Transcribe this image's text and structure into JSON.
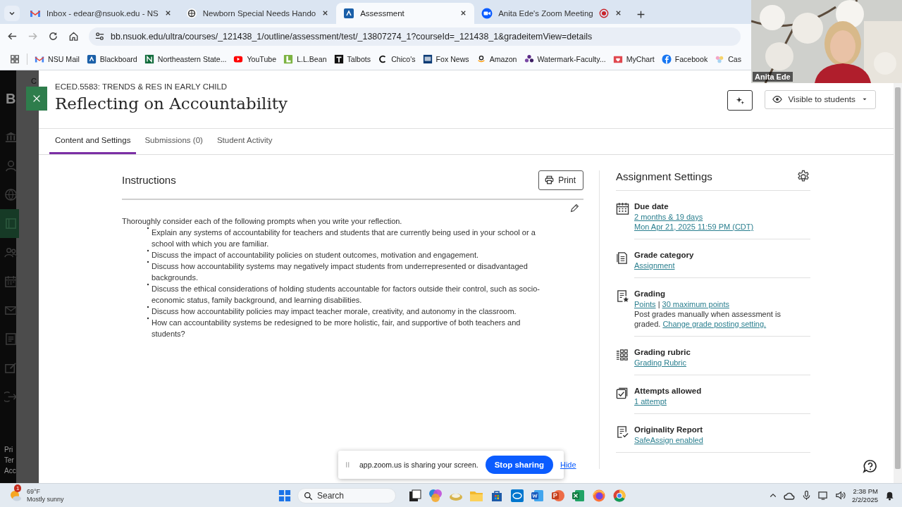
{
  "browser": {
    "tabs": [
      {
        "title": "Inbox - edear@nsuok.edu - NS",
        "selected": false,
        "recording": false
      },
      {
        "title": "Newborn Special Needs Hando",
        "selected": false,
        "recording": false
      },
      {
        "title": "Assessment",
        "selected": true,
        "recording": false
      },
      {
        "title": "Anita Ede's Zoom Meeting",
        "selected": false,
        "recording": true
      }
    ],
    "forward_disabled": true,
    "url": "bb.nsuok.edu/ultra/courses/_121438_1/outline/assessment/test/_13807274_1?courseId=_121438_1&gradeitemView=details",
    "bookmarks": [
      "NSU Mail",
      "Blackboard",
      "Northeastern State...",
      "YouTube",
      "L.L.Bean",
      "Talbots",
      "Chico's",
      "Fox News",
      "Amazon",
      "Watermark-Faculty...",
      "MyChart",
      "Facebook",
      "Cas"
    ]
  },
  "video": {
    "name": "Anita Ede"
  },
  "backdrop": {
    "top_texts": [
      "C",
      "B"
    ],
    "bottom_texts": [
      "Pri",
      "Ter",
      "Acc"
    ],
    "nav": [
      {
        "selected": false
      },
      {
        "selected": false
      },
      {
        "selected": false
      },
      {
        "selected": true
      },
      {
        "selected": false
      },
      {
        "selected": false
      },
      {
        "selected": false
      },
      {
        "selected": false
      },
      {
        "selected": false
      },
      {
        "selected": false
      }
    ]
  },
  "panel": {
    "course": "ECED.5583: TRENDS & RES IN EARLY CHILD",
    "title": "Reflecting on Accountability",
    "visibility": "Visible to students",
    "tabs": [
      {
        "label": "Content and Settings",
        "selected": true
      },
      {
        "label": "Submissions (0)",
        "selected": false
      },
      {
        "label": "Student Activity",
        "selected": false
      }
    ],
    "instructions": {
      "heading": "Instructions",
      "print": "Print",
      "intro": "Thoroughly consider each of the following prompts when you write your reflection.",
      "bullets": [
        "Explain any systems of accountability for teachers and students that are currently being used in your school or a school with which you are familiar.",
        "Discuss the impact of accountability policies on student outcomes, motivation and engagement.",
        "Discuss how accountability systems may negatively impact students from underrepresented or disadvantaged backgrounds.",
        "Discuss the ethical considerations of holding students accountable for factors outside their control, such as socio-economic status, family background, and learning disabilities.",
        "Discuss how accountability policies may impact teacher morale, creativity, and autonomy in the classroom.",
        "How can accountability systems be redesigned to be more holistic, fair, and supportive of both teachers and students?"
      ]
    },
    "settings": {
      "title": "Assignment Settings",
      "items": [
        {
          "label": "Due date",
          "lines": [
            [
              {
                "text": "2 months & 19 days",
                "link": true
              }
            ],
            [
              {
                "text": "Mon Apr 21, 2025 11:59 PM (CDT)",
                "link": true
              }
            ]
          ]
        },
        {
          "label": "Grade category",
          "lines": [
            [
              {
                "text": "Assignment",
                "link": true
              }
            ]
          ]
        },
        {
          "label": "Grading",
          "lines": [
            [
              {
                "text": "Points",
                "link": true
              },
              {
                "text": "|",
                "link": false
              },
              {
                "text": "30 maximum points",
                "link": true
              }
            ],
            [
              {
                "text": "Post grades manually when assessment is graded.",
                "link": false
              },
              {
                "text": "Change grade posting setting.",
                "link": true
              }
            ]
          ]
        },
        {
          "label": "Grading rubric",
          "lines": [
            [
              {
                "text": "Grading Rubric",
                "link": true
              }
            ]
          ]
        },
        {
          "label": "Attempts allowed",
          "lines": [
            [
              {
                "text": "1 attempt",
                "link": true
              }
            ]
          ]
        },
        {
          "label": "Originality Report",
          "lines": [
            [
              {
                "text": "SafeAssign enabled",
                "link": true
              }
            ]
          ]
        }
      ]
    }
  },
  "share_bar": {
    "message": "app.zoom.us is sharing your screen.",
    "stop": "Stop sharing",
    "hide": "Hide"
  },
  "taskbar": {
    "weather": {
      "alerts": "1",
      "temperature": "69°F",
      "condition": "Mostly sunny"
    },
    "search_placeholder": "Search",
    "time": "2:38 PM",
    "date": "2/2/2025"
  }
}
